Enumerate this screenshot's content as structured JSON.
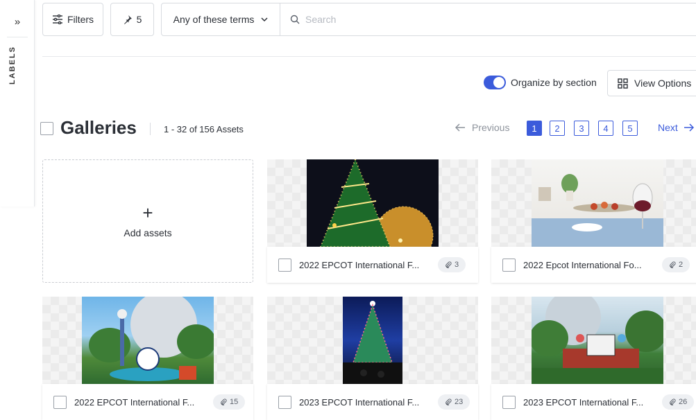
{
  "rail": {
    "expand_glyph": "»",
    "label": "LABELS"
  },
  "toolbar": {
    "filters_label": "Filters",
    "pin_count": "5",
    "terms_label": "Any of these terms",
    "search_placeholder": "Search"
  },
  "view": {
    "organize_label": "Organize by section",
    "organize_on": true,
    "view_options_label": "View Options"
  },
  "heading": {
    "title": "Galleries",
    "count": "1 - 32 of 156 Assets"
  },
  "pagination": {
    "prev_label": "Previous",
    "next_label": "Next",
    "pages": [
      "1",
      "2",
      "3",
      "4",
      "5"
    ],
    "current": "1"
  },
  "add_card": {
    "plus": "+",
    "label": "Add assets"
  },
  "cards": [
    {
      "title": "2022 EPCOT International F...",
      "count": "3"
    },
    {
      "title": "2022 Epcot International Fo...",
      "count": "2"
    },
    {
      "title": "2022 EPCOT International F...",
      "count": "15"
    },
    {
      "title": "2023 EPCOT International F...",
      "count": "23"
    },
    {
      "title": "2023 EPCOT International F...",
      "count": "26"
    }
  ],
  "colors": {
    "accent": "#3b5bdb",
    "text": "#2b2f36",
    "muted": "#8c929b"
  }
}
